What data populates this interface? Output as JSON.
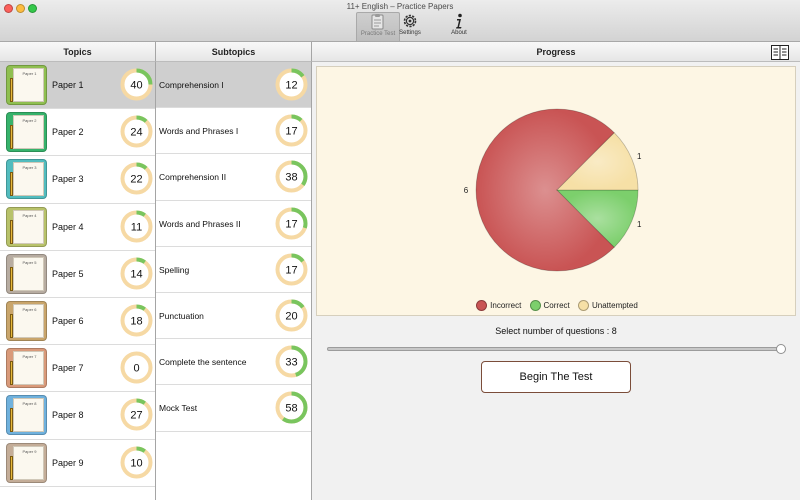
{
  "window": {
    "title": "11+ English – Practice Papers"
  },
  "toolbar": {
    "items": [
      {
        "label": "Practice Test",
        "icon": "practice-test-icon",
        "active": true
      },
      {
        "label": "Settings",
        "icon": "gear-icon",
        "active": false
      },
      {
        "label": "About",
        "icon": "info-icon",
        "active": false
      }
    ]
  },
  "columns": {
    "topics": "Topics",
    "subtopics": "Subtopics",
    "progress": "Progress"
  },
  "topics": [
    {
      "label": "Paper 1",
      "thumb": "Paper 1",
      "count": "40",
      "color": "#8fbf50",
      "fill": 0.25,
      "selected": true
    },
    {
      "label": "Paper 2",
      "thumb": "Paper 2",
      "count": "24",
      "color": "#36b26b",
      "fill": 0.12
    },
    {
      "label": "Paper 3",
      "thumb": "Paper 3",
      "count": "22",
      "color": "#52bcbe",
      "fill": 0.12
    },
    {
      "label": "Paper 4",
      "thumb": "Paper 4",
      "count": "11",
      "color": "#b8c26a",
      "fill": 0.1
    },
    {
      "label": "Paper 5",
      "thumb": "Paper 5",
      "count": "14",
      "color": "#b7aca1",
      "fill": 0.1
    },
    {
      "label": "Paper 6",
      "thumb": "Paper 6",
      "count": "18",
      "color": "#c9a56b",
      "fill": 0.1
    },
    {
      "label": "Paper 7",
      "thumb": "Paper 7",
      "count": "0",
      "color": "#d99a7a",
      "fill": 0.0
    },
    {
      "label": "Paper 8",
      "thumb": "Paper 8",
      "count": "27",
      "color": "#6fb1dd",
      "fill": 0.1
    },
    {
      "label": "Paper 9",
      "thumb": "Paper 9",
      "count": "10",
      "color": "#c4ad98",
      "fill": 0.1
    }
  ],
  "subtopics": [
    {
      "label": "Comprehension I",
      "count": "12",
      "fill": 0.15,
      "selected": true
    },
    {
      "label": "Words and Phrases I",
      "count": "17",
      "fill": 0.12
    },
    {
      "label": "Comprehension II",
      "count": "38",
      "fill": 0.35
    },
    {
      "label": "Words and Phrases II",
      "count": "17",
      "fill": 0.3
    },
    {
      "label": "Spelling",
      "count": "17",
      "fill": 0.15
    },
    {
      "label": "Punctuation",
      "count": "20",
      "fill": 0.15
    },
    {
      "label": "Complete the sentence",
      "count": "33",
      "fill": 0.45
    },
    {
      "label": "Mock Test",
      "count": "58",
      "fill": 0.6
    }
  ],
  "chart_data": {
    "type": "pie",
    "series": [
      {
        "name": "Incorrect",
        "value": 6,
        "color": "#c95454"
      },
      {
        "name": "Correct",
        "value": 1,
        "color": "#7ccf6c"
      },
      {
        "name": "Unattempted",
        "value": 1,
        "color": "#f6e0a6"
      }
    ],
    "legend_placement": "bottom"
  },
  "legend": {
    "incorrect": "Incorrect",
    "correct": "Correct",
    "unattempted": "Unattempted"
  },
  "selector": {
    "label": "Select number of questions : 8",
    "value": 8,
    "fraction": 1.0
  },
  "begin_button": "Begin The Test",
  "colors": {
    "ring_track": "#f6d9a4",
    "ring_progress": "#79c55e",
    "button_border": "#7b4d3a"
  }
}
